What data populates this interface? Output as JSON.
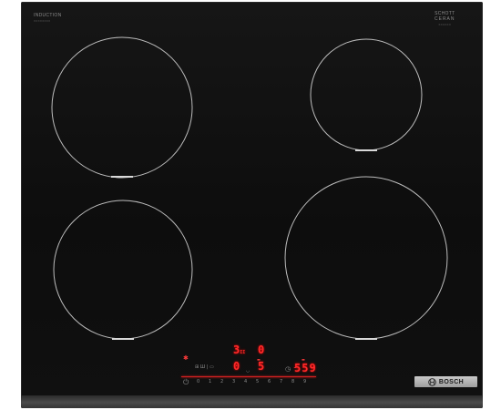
{
  "brand": {
    "top_left_line1": "INDUCTION",
    "top_left_line2": "XXXXXXXX",
    "top_right_line1": "SCHOTT",
    "top_right_line2": "CERAN",
    "top_right_line3": "XXXXXX",
    "logo_text": "BOSCH"
  },
  "controls": {
    "display_top_left": "3",
    "display_top_left_sub": "II",
    "display_top_right": "0",
    "display_mid_left": "0",
    "display_mid_right": "5",
    "timer_value": "559",
    "power_symbol": "⏻",
    "scale": [
      "0",
      "1",
      "2",
      "3",
      "4",
      "5",
      "6",
      "7",
      "8",
      "9"
    ]
  },
  "colors": {
    "panel": "#121212",
    "led": "#ff2a2a",
    "zone_outline": "#bdbdbd"
  }
}
